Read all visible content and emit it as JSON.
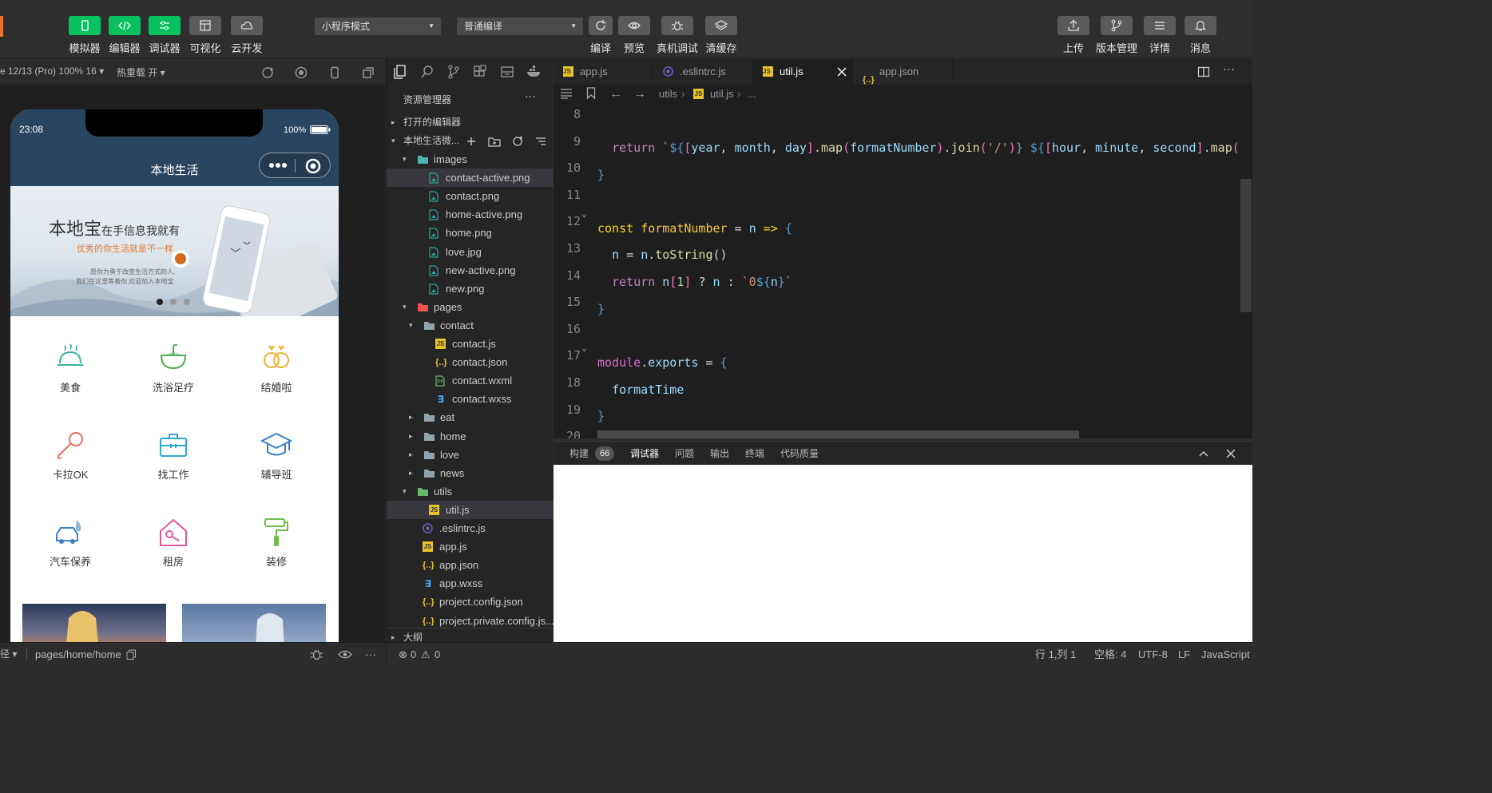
{
  "toolbar": {
    "left_buttons": [
      {
        "label": "模拟器",
        "icon": "phone-icon"
      },
      {
        "label": "编辑器",
        "icon": "code-icon"
      },
      {
        "label": "调试器",
        "icon": "debug-icon"
      },
      {
        "label": "可视化",
        "icon": "layout-icon"
      },
      {
        "label": "云开发",
        "icon": "cloud-icon"
      }
    ],
    "mode_select": "小程序模式",
    "compile_select": "普通编译",
    "mid_buttons": [
      {
        "label": "编译",
        "icon": "refresh-icon"
      },
      {
        "label": "预览",
        "icon": "eye-icon"
      },
      {
        "label": "真机调试",
        "icon": "bug-icon"
      },
      {
        "label": "清缓存",
        "icon": "layers-icon"
      }
    ],
    "right_buttons": [
      {
        "label": "上传",
        "icon": "upload-icon"
      },
      {
        "label": "版本管理",
        "icon": "branch-icon"
      },
      {
        "label": "详情",
        "icon": "menu-icon"
      },
      {
        "label": "消息",
        "icon": "bell-icon"
      }
    ],
    "accent": "#07c160"
  },
  "simulator": {
    "device": "e 12/13 (Pro) 100% 16 ▾",
    "hotreload": "热重载 开 ▾",
    "time": "23:08",
    "battery": "100%",
    "nav_title": "本地生活",
    "banner": {
      "headline": "本地宝",
      "headline_rest": "在手信息我就有",
      "sub": "优秀的你生活就是不一样",
      "line1": "愿你为勇于改变生活方式的人,",
      "line2": "我们在这里等着你,欢迎加入本地宝",
      "active_dot": 1,
      "dots": 3
    },
    "grid": [
      {
        "label": "美食",
        "icon": "food-cover-icon",
        "color": "#36b39c"
      },
      {
        "label": "洗浴足疗",
        "icon": "bath-icon",
        "color": "#4caf50"
      },
      {
        "label": "结婚啦",
        "icon": "rings-icon",
        "color": "#f2b134"
      },
      {
        "label": "卡拉OK",
        "icon": "microphone-icon",
        "color": "#ef6a5a"
      },
      {
        "label": "找工作",
        "icon": "briefcase-icon",
        "color": "#2aa9c9"
      },
      {
        "label": "辅导班",
        "icon": "graduation-cap-icon",
        "color": "#3b82c4"
      },
      {
        "label": "汽车保养",
        "icon": "car-care-icon",
        "color": "#3b82c4"
      },
      {
        "label": "租房",
        "icon": "house-key-icon",
        "color": "#e05a9a"
      },
      {
        "label": "装修",
        "icon": "paint-roller-icon",
        "color": "#6cbf4a"
      }
    ]
  },
  "explorer": {
    "title": "资源管理器",
    "open_editors": "打开的编辑器",
    "project": "本地生活微...",
    "tree": [
      {
        "name": "images",
        "depth": 1,
        "type": "folder-open",
        "arrow": "▾",
        "color": "#4db6ac"
      },
      {
        "name": "contact-active.png",
        "depth": 2,
        "type": "image",
        "sel": true
      },
      {
        "name": "contact.png",
        "depth": 2,
        "type": "image"
      },
      {
        "name": "home-active.png",
        "depth": 2,
        "type": "image"
      },
      {
        "name": "home.png",
        "depth": 2,
        "type": "image"
      },
      {
        "name": "love.jpg",
        "depth": 2,
        "type": "image"
      },
      {
        "name": "new-active.png",
        "depth": 2,
        "type": "image"
      },
      {
        "name": "new.png",
        "depth": 2,
        "type": "image"
      },
      {
        "name": "pages",
        "depth": 1,
        "type": "folder-open",
        "arrow": "▾",
        "color": "#ef5350"
      },
      {
        "name": "contact",
        "depth": 2,
        "type": "folder-open",
        "arrow": "▾",
        "color": "#90a4ae"
      },
      {
        "name": "contact.js",
        "depth": 3,
        "type": "js"
      },
      {
        "name": "contact.json",
        "depth": 3,
        "type": "json"
      },
      {
        "name": "contact.wxml",
        "depth": 3,
        "type": "wxml"
      },
      {
        "name": "contact.wxss",
        "depth": 3,
        "type": "wxss"
      },
      {
        "name": "eat",
        "depth": 2,
        "type": "folder",
        "arrow": "▸",
        "color": "#90a4ae"
      },
      {
        "name": "home",
        "depth": 2,
        "type": "folder",
        "arrow": "▸",
        "color": "#90a4ae"
      },
      {
        "name": "love",
        "depth": 2,
        "type": "folder",
        "arrow": "▸",
        "color": "#90a4ae"
      },
      {
        "name": "news",
        "depth": 2,
        "type": "folder",
        "arrow": "▸",
        "color": "#90a4ae"
      },
      {
        "name": "utils",
        "depth": 1,
        "type": "folder-open",
        "arrow": "▾",
        "color": "#66bb6a"
      },
      {
        "name": "util.js",
        "depth": 2,
        "type": "js",
        "sel": true
      },
      {
        "name": ".eslintrc.js",
        "depth": 1,
        "type": "eslint"
      },
      {
        "name": "app.js",
        "depth": 1,
        "type": "js"
      },
      {
        "name": "app.json",
        "depth": 1,
        "type": "json"
      },
      {
        "name": "app.wxss",
        "depth": 1,
        "type": "wxss"
      },
      {
        "name": "project.config.json",
        "depth": 1,
        "type": "json"
      },
      {
        "name": "project.private.config.js...",
        "depth": 1,
        "type": "json"
      }
    ],
    "outline": "大纲"
  },
  "editor": {
    "tabs": [
      {
        "name": "app.js",
        "type": "js"
      },
      {
        "name": ".eslintrc.js",
        "type": "eslint"
      },
      {
        "name": "util.js",
        "type": "js",
        "active": true
      },
      {
        "name": "app.json",
        "type": "json"
      }
    ],
    "breadcrumb": [
      "utils",
      "util.js",
      "..."
    ],
    "line_numbers": [
      "8",
      "9",
      "10",
      "11",
      "12",
      "13",
      "14",
      "15",
      "16",
      "17",
      "18",
      "19",
      "20"
    ]
  },
  "panel": {
    "tabs": [
      "构建",
      "调试器",
      "问题",
      "输出",
      "终端",
      "代码质量"
    ],
    "build_count": "66",
    "active_tab": "调试器"
  },
  "status": {
    "path_label": "径 ▾",
    "path": "pages/home/home",
    "errors": "0",
    "warnings": "0",
    "position": "行 1,列 1",
    "spaces": "空格: 4",
    "encoding": "UTF-8",
    "eol": "LF",
    "language": "JavaScript"
  }
}
